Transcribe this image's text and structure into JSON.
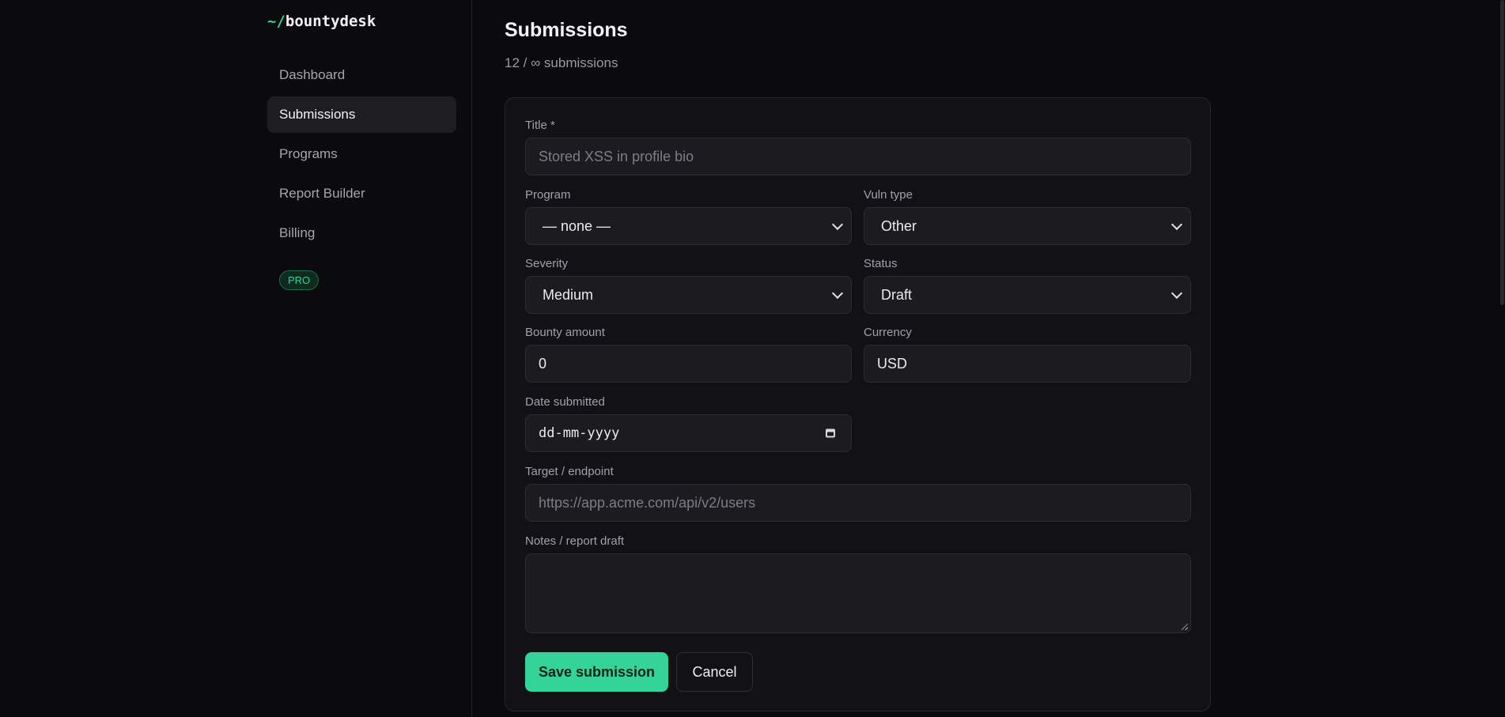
{
  "brand": {
    "prefix": "~/",
    "name": "bountydesk"
  },
  "sidebar": {
    "items": [
      {
        "label": "Dashboard",
        "active": false
      },
      {
        "label": "Submissions",
        "active": true
      },
      {
        "label": "Programs",
        "active": false
      },
      {
        "label": "Report Builder",
        "active": false
      },
      {
        "label": "Billing",
        "active": false
      }
    ],
    "plan_badge": "PRO"
  },
  "page": {
    "title": "Submissions",
    "subtitle": "12 / ∞ submissions"
  },
  "form": {
    "title": {
      "label": "Title *",
      "value": "",
      "placeholder": "Stored XSS in profile bio"
    },
    "program": {
      "label": "Program",
      "selected": "— none —"
    },
    "vuln_type": {
      "label": "Vuln type",
      "selected": "Other"
    },
    "severity": {
      "label": "Severity",
      "selected": "Medium"
    },
    "status": {
      "label": "Status",
      "selected": "Draft"
    },
    "bounty_amount": {
      "label": "Bounty amount",
      "value": "0"
    },
    "currency": {
      "label": "Currency",
      "value": "USD"
    },
    "date_submitted": {
      "label": "Date submitted",
      "placeholder": "dd-mm-yyyy"
    },
    "target": {
      "label": "Target / endpoint",
      "value": "",
      "placeholder": "https://app.acme.com/api/v2/users"
    },
    "notes": {
      "label": "Notes / report draft",
      "value": ""
    },
    "save_label": "Save submission",
    "cancel_label": "Cancel"
  },
  "colors": {
    "accent": "#34d399",
    "background": "#0b0b0d",
    "card": "#121216",
    "input": "#1b1b20"
  }
}
